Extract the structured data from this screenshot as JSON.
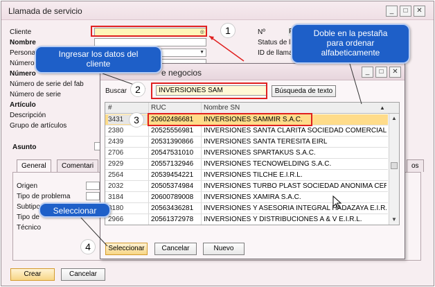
{
  "window": {
    "title": "Llamada de servicio",
    "min": "_",
    "max": "□",
    "close": "✕"
  },
  "form": {
    "left_labels": [
      "Cliente",
      "Nombre",
      "Persona",
      "Número",
      "Número",
      "Número de serie del fab",
      "Número de serie",
      "Artículo",
      "Descripción",
      "Grupo de artículos"
    ],
    "right_labels": [
      "Nº",
      "Status de ll",
      "ID de llama"
    ],
    "no_value": "P",
    "asunto": "Asunto"
  },
  "tabs": {
    "general": "General",
    "comentario": "Comentari",
    "right_tab": "os"
  },
  "general_fields": [
    "Origen",
    "Tipo de problema",
    "Subtipo",
    "Tipo de",
    "Técnico"
  ],
  "bottom_buttons": {
    "crear": "Crear",
    "cancelar": "Cancelar"
  },
  "dialog": {
    "title": "e negocios",
    "search_label": "Buscar",
    "search_value": "INVERSIONES SAM",
    "text_search_button": "Búsqueda de texto",
    "col_hash": "#",
    "col_ruc": "RUC",
    "col_name": "Nombre SN",
    "rows": [
      {
        "id": "3431",
        "ruc": "20602486681",
        "name": "INVERSIONES SAMMIR S.A.C."
      },
      {
        "id": "2380",
        "ruc": "20525556981",
        "name": "INVERSIONES SANTA CLARITA SOCIEDAD COMERCIAL"
      },
      {
        "id": "2439",
        "ruc": "20531390866",
        "name": "INVERSIONES SANTA TERESITA EIRL"
      },
      {
        "id": "2706",
        "ruc": "20547531010",
        "name": "INVERSIONES SPARTAKUS S.A.C."
      },
      {
        "id": "2929",
        "ruc": "20557132946",
        "name": "INVERSIONES TECNOWELDING S.A.C."
      },
      {
        "id": "2564",
        "ruc": "20539454221",
        "name": "INVERSIONES TILCHE E.I.R.L."
      },
      {
        "id": "2032",
        "ruc": "20505374984",
        "name": "INVERSIONES TURBO PLAST SOCIEDAD ANONIMA CERI"
      },
      {
        "id": "3184",
        "ruc": "20600789008",
        "name": "INVERSIONES XAMIRA S.A.C."
      },
      {
        "id": "3180",
        "ruc": "20563436281",
        "name": "INVERSIONES Y ASESORIA INTEGRAL HADAZAYA E.I.R."
      },
      {
        "id": "2966",
        "ruc": "20561372978",
        "name": "INVERSIONES Y DISTRIBUCIONES A & V E.I.R.L."
      }
    ],
    "btn_select": "Seleccionar",
    "btn_cancel": "Cancelar",
    "btn_new": "Nuevo"
  },
  "callouts": {
    "ingresar_l1": "Ingresar los datos del",
    "ingresar_l2": "cliente",
    "doble_l1": "Doble en la pestaña",
    "doble_l2": "para ordenar",
    "doble_l3": "alfabeticamente",
    "seleccionar": "Seleccionar",
    "n1": "1",
    "n2": "2",
    "n3": "3",
    "n4": "4"
  },
  "colors": {
    "accent_red": "#e02020",
    "callout_blue": "#1e5fc8",
    "selected_row": "#ffdc8a",
    "field_yellow": "#fff6b8"
  }
}
